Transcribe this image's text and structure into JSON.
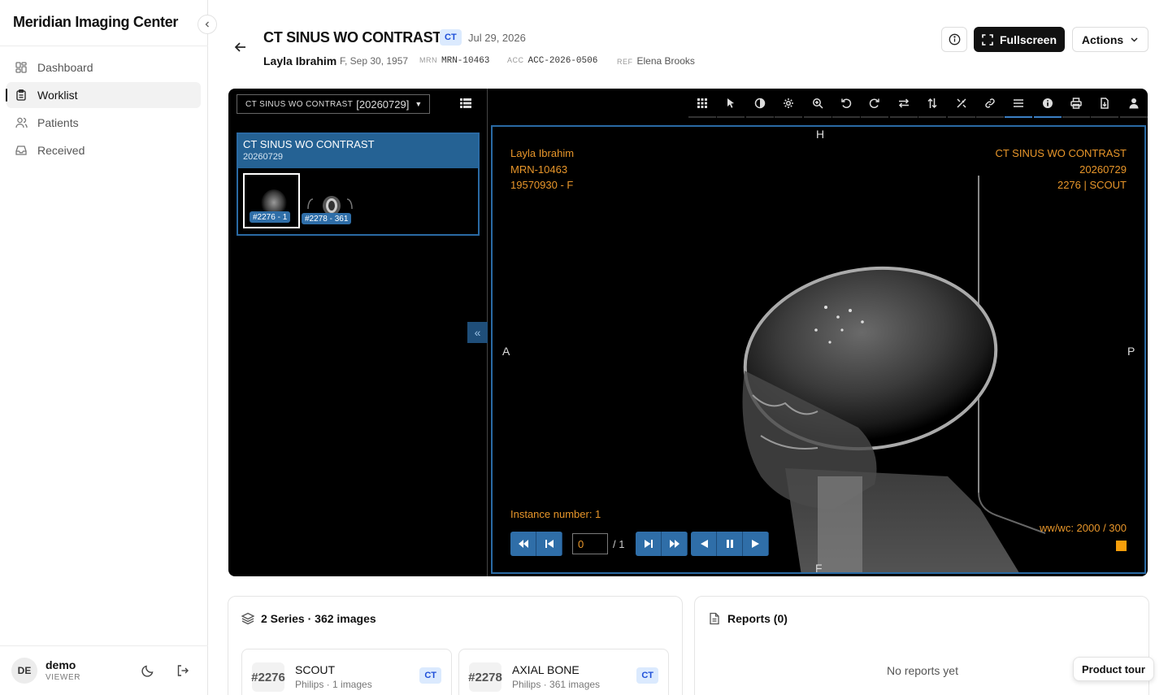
{
  "app": {
    "title": "Meridian Imaging Center"
  },
  "sidebar": {
    "items": [
      {
        "label": "Dashboard",
        "icon": "dashboard-icon"
      },
      {
        "label": "Worklist",
        "icon": "clipboard-icon",
        "active": true
      },
      {
        "label": "Patients",
        "icon": "users-icon"
      },
      {
        "label": "Received",
        "icon": "inbox-icon"
      }
    ],
    "user": {
      "initials": "DE",
      "name": "demo",
      "role": "VIEWER"
    }
  },
  "header": {
    "title": "CT SINUS WO CONTRAST",
    "modality": "CT",
    "date": "Jul 29, 2026",
    "patient_name": "Layla Ibrahim",
    "patient_demo": "F, Sep 30, 1957",
    "mrn_label": "MRN",
    "mrn": "MRN-10463",
    "acc_label": "ACC",
    "acc": "ACC-2026-0506",
    "ref_label": "REF",
    "ref": "Elena Brooks",
    "fullscreen_label": "Fullscreen",
    "actions_label": "Actions"
  },
  "viewer": {
    "study_select": {
      "desc": "CT SINUS WO CONTRAST",
      "date": "[20260729]"
    },
    "study_card": {
      "title": "CT SINUS WO CONTRAST",
      "date": "20260729"
    },
    "thumbnails": [
      {
        "label": "#2276 - 1"
      },
      {
        "label": "#2278 - 361"
      }
    ],
    "overlay": {
      "tl": [
        "Layla Ibrahim",
        "MRN-10463",
        "19570930 - F"
      ],
      "tr": [
        "CT SINUS WO CONTRAST",
        "20260729",
        "2276 | SCOUT"
      ],
      "instance": "Instance number: 1",
      "wwwc": "ww/wc: 2000 / 300"
    },
    "orientation": {
      "top": "H",
      "bottom": "F",
      "left": "A",
      "right": "P"
    },
    "cine": {
      "frame_value": "0",
      "frame_total": "/ 1"
    },
    "tools": [
      "grid-icon",
      "pointer-icon",
      "contrast-icon",
      "gear-icon",
      "zoom-icon",
      "rotate-left-icon",
      "rotate-right-icon",
      "flip-horizontal-icon",
      "flip-vertical-icon",
      "tools-icon",
      "link-icon",
      "menu-icon",
      "info-icon",
      "print-icon",
      "download-icon",
      "person-icon"
    ],
    "colors": {
      "overlay": "#e8962a",
      "accent": "#2f6ea8"
    }
  },
  "series_card": {
    "title": "2 Series · 362 images",
    "items": [
      {
        "num": "#2276",
        "desc": "SCOUT",
        "meta": "Philips · 1 images",
        "modality": "CT"
      },
      {
        "num": "#2278",
        "desc": "AXIAL BONE",
        "meta": "Philips · 361 images",
        "modality": "CT"
      }
    ]
  },
  "reports_card": {
    "title": "Reports (0)",
    "empty": "No reports yet"
  },
  "product_tour": "Product tour"
}
